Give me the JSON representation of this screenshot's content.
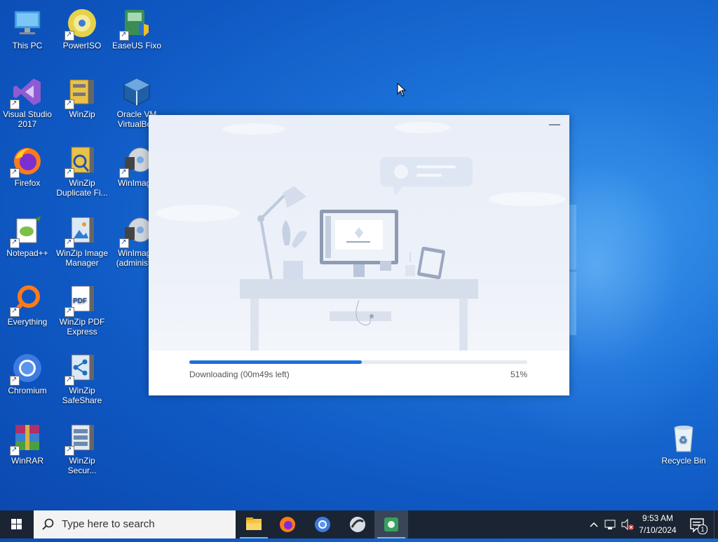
{
  "desktop": {
    "icons": [
      {
        "label": "This PC",
        "icon": "monitor-icon"
      },
      {
        "label": "PowerISO",
        "icon": "disc-icon"
      },
      {
        "label": "EaseUS Fixo",
        "icon": "easeus-icon"
      },
      {
        "label": "Visual Studio 2017",
        "icon": "visual-studio-icon"
      },
      {
        "label": "WinZip",
        "icon": "winzip-icon"
      },
      {
        "label": "Oracle VM VirtualBox",
        "icon": "virtualbox-icon"
      },
      {
        "label": "Firefox",
        "icon": "firefox-icon"
      },
      {
        "label": "WinZip Duplicate Fi...",
        "icon": "winzip-duplicate-icon"
      },
      {
        "label": "WinImage",
        "icon": "winimage-icon"
      },
      {
        "label": "Notepad++",
        "icon": "notepadpp-icon"
      },
      {
        "label": "WinZip Image Manager",
        "icon": "winzip-image-icon"
      },
      {
        "label": "WinImage (administ...",
        "icon": "winimage-admin-icon"
      },
      {
        "label": "Everything",
        "icon": "everything-icon"
      },
      {
        "label": "WinZip PDF Express",
        "icon": "winzip-pdf-icon"
      },
      {
        "label": "Chromium",
        "icon": "chromium-icon"
      },
      {
        "label": "WinZip SafeShare",
        "icon": "winzip-safeshare-icon"
      },
      {
        "label": "WinRAR",
        "icon": "winrar-icon"
      },
      {
        "label": "WinZip Secur...",
        "icon": "winzip-secure-icon"
      },
      {
        "label": "Recycle Bin",
        "icon": "recycle-bin-icon"
      }
    ]
  },
  "installer": {
    "minimize_glyph": "—",
    "progress_percent": 51,
    "status_text": "Downloading (00m49s left)",
    "percent_text": "51%"
  },
  "taskbar": {
    "search_placeholder": "Type here to search",
    "apps": [
      "file-explorer-icon",
      "firefox-icon",
      "chromium-icon",
      "installer-app-icon",
      "easeus-app-icon"
    ],
    "clock_time": "9:53 AM",
    "clock_date": "7/10/2024",
    "notification_count": "1"
  },
  "colors": {
    "accent": "#1e6fe0",
    "taskbar": "#1b2433"
  }
}
